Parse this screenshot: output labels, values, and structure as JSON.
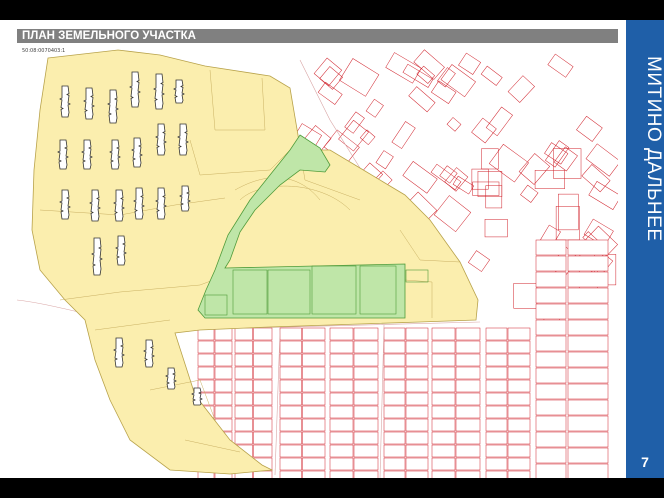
{
  "header": {
    "title": "ПЛАН ЗЕМЕЛЬНОГО УЧАСТКА"
  },
  "panel": {
    "title": "МИТИНО ДАЛЬНЕЕ",
    "page_number": "7"
  },
  "map": {
    "cadastral_number": "50:08:0070403:1",
    "colors": {
      "plot_fill": "#fbeeae",
      "plot_stroke": "#b8a24a",
      "park_fill": "#bfe6a8",
      "park_stroke": "#4f9b3a",
      "parcel_stroke": "#d0212a",
      "panel": "#1f5fa8",
      "header": "#808080"
    }
  }
}
